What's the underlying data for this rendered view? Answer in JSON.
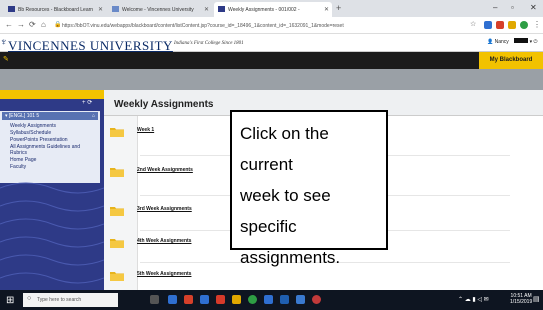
{
  "browser": {
    "tabs": [
      {
        "label": "Bb Resources - Blackboard Learn"
      },
      {
        "label": "Welcome - Vincennes University"
      },
      {
        "label": "Weekly Assignments - 001/002 - "
      }
    ],
    "url": "https://bbOT.vinu.edu/webapps/blackboard/content/listContent.jsp?course_id=_18496_1&content_id=_1632091_1&mode=reset",
    "colors": {
      "tabbar": "#dee1e6"
    }
  },
  "site": {
    "logo": "VINCENNES UNIVERSITY",
    "tagline": "Indiana's First College Since 1801",
    "user_name": "Nancy",
    "my_blackboard": "My Blackboard",
    "colors": {
      "brand_blue": "#2e3a87",
      "gold": "#f2c200"
    }
  },
  "sidebar": {
    "course": "[ENGL] 101 5",
    "items": [
      {
        "label": "Weekly Assignments"
      },
      {
        "label": "Syllabus/Schedule"
      },
      {
        "label": "PowerPoints Presentation"
      },
      {
        "label": "All Assignments Guidelines and Rubrics"
      },
      {
        "label": "Home Page"
      },
      {
        "label": "Faculty"
      }
    ]
  },
  "main": {
    "title": "Weekly Assignments",
    "items": [
      {
        "label": "Week 1",
        "icon": "folder-icon"
      },
      {
        "label": "2nd Week Assignments",
        "icon": "folder-icon"
      },
      {
        "label": "3rd Week Assignments",
        "icon": "folder-icon"
      },
      {
        "label": "4th Week Assignments",
        "icon": "folder-icon"
      },
      {
        "label": "5th Week Assignments",
        "icon": "folder-icon"
      }
    ]
  },
  "callout": {
    "lines": [
      "Click on the current",
      "week to see specific",
      "assignments."
    ]
  },
  "taskbar": {
    "search_placeholder": "Type here to search",
    "time": "10:51 AM",
    "date": "1/15/2019"
  }
}
